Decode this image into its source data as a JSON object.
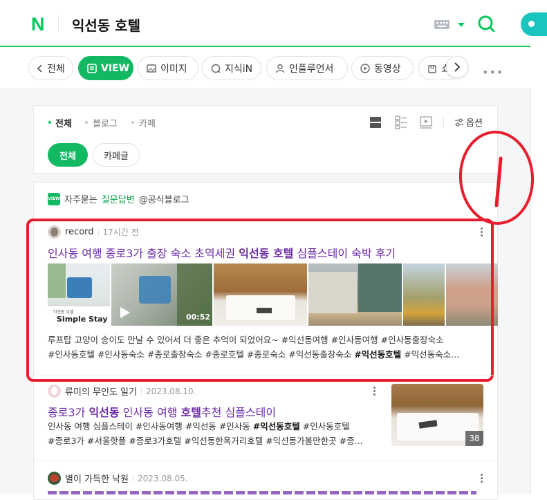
{
  "header": {
    "logo": "N",
    "query": "익선동 호텔"
  },
  "tabs": [
    {
      "label": "전체"
    },
    {
      "label": "VIEW"
    },
    {
      "label": "이미지"
    },
    {
      "label": "지식iN"
    },
    {
      "label": "인플루언서"
    },
    {
      "label": "동영상"
    },
    {
      "label": "쇼"
    }
  ],
  "filter": {
    "tabs": [
      "전체",
      "블로그",
      "카페"
    ],
    "options_label": "옵션",
    "pills": [
      "전체",
      "카페글"
    ]
  },
  "qa_bar": {
    "badge": "VIEW",
    "prefix": "자주묻는",
    "highlight": "질문답변",
    "suffix": "@공식블로그"
  },
  "results": [
    {
      "author": "record",
      "time": "17시간 전",
      "title_a": "인사동 여행 종로3가 출장 숙소 초역세권 ",
      "title_b": "익선동 호텔",
      "title_c": " 심플스테이 숙박 후기",
      "thumb1_small": "익선동 호텔",
      "thumb1_label": "Simple Stay",
      "video_duration": "00:52",
      "snippet_line1": "루프탑 고양이 송이도 만날 수 있어서 더 좋은 추억이 되었어요~ #익선동여행 #인사동여행 #인사동출장숙소",
      "snippet_line2a": "#인사동호텔 #인사동숙소 #종로출장숙소 #종로호텔 #종로숙소 #익선동출장숙소 ",
      "snippet_line2b": "#익선동호텔",
      "snippet_line2c": " #익선동숙소..."
    },
    {
      "author": "류미의 무인도 일기",
      "time": "2023.08.10.",
      "title_a": "종로3가 ",
      "title_b": "익선동",
      "title_c": " 인사동 여행 ",
      "title_d": "호텔",
      "title_e": "추천 심플스테이",
      "snippet_line1a": "인사동 여행 심플스테이 #인사동여행 #익선동 #인사동 ",
      "snippet_line1b": "#익선동호텔",
      "snippet_line1c": " #인사동호텔",
      "snippet_line2": "#종로3가 #서울핫플 #종로3가호텔 #익선동한옥거리호텔 #익선동가볼만한곳 #종...",
      "photo_count": "38"
    },
    {
      "author": "별이 가득한 낙원",
      "time": "2023.08.05."
    }
  ],
  "annotation": {
    "mark": "1",
    "color": "#e81d2d"
  },
  "colors": {
    "naver_green": "#03c75a",
    "tab_active": "#13b863",
    "title_purple": "#6b2ba6"
  }
}
